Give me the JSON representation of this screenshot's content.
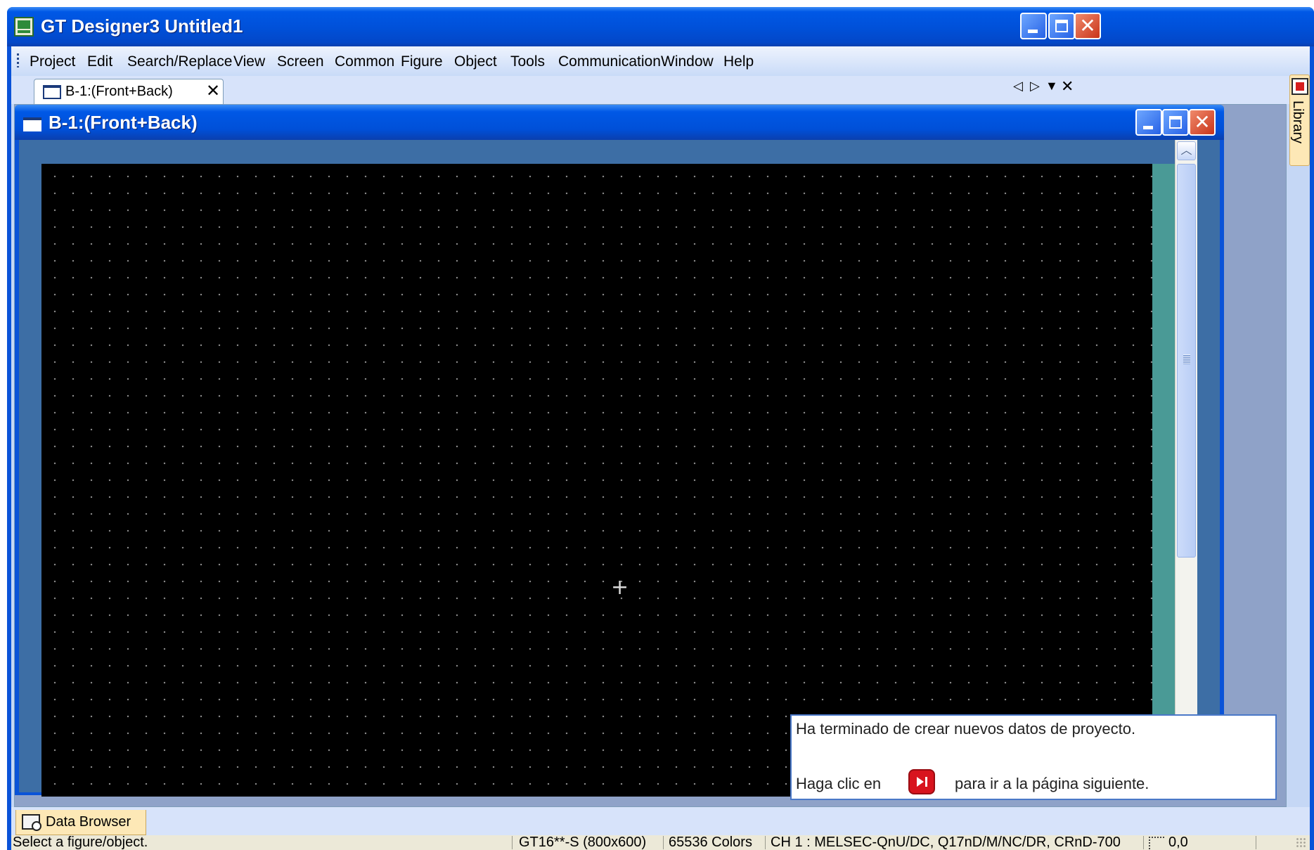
{
  "window": {
    "title": "GT Designer3 Untitled1"
  },
  "menu": {
    "items": [
      "Project",
      "Edit",
      "Search/Replace",
      "View",
      "Screen",
      "Common",
      "Figure",
      "Object",
      "Tools",
      "Communication",
      "Window",
      "Help"
    ]
  },
  "document_tab": {
    "label": "B-1:(Front+Back)"
  },
  "child_window": {
    "title": "B-1:(Front+Back)"
  },
  "canvas": {
    "background": "#000000",
    "grid_dot_color": "#8c8c8c",
    "crosshair": "+"
  },
  "balloon": {
    "line1": "Ha terminado de crear nuevos datos de proyecto.",
    "line2_before": "Haga clic en",
    "line2_after": "para ir a la página siguiente.",
    "icon": "next-page-icon"
  },
  "side_panel": {
    "library_label": "Library"
  },
  "dock": {
    "data_browser_label": "Data Browser"
  },
  "status_bar": {
    "message": "Select a figure/object.",
    "model": "GT16**-S (800x600)",
    "colors": "65536 Colors",
    "channel": "CH 1 : MELSEC-QnU/DC, Q17nD/M/NC/DR, CRnD-700",
    "coordinates": "0,0"
  },
  "colors": {
    "xp_blue": "#0058e6",
    "accent_orange": "#fde8b6",
    "close_red": "#c9341a"
  }
}
